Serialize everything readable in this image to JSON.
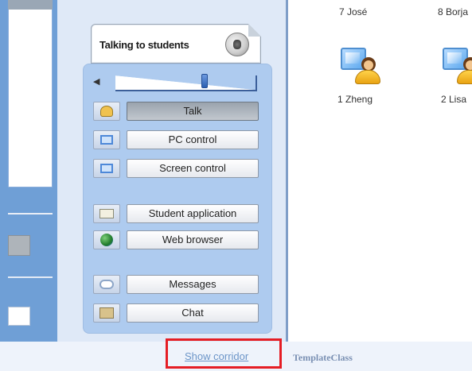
{
  "panel": {
    "tab_title": "Talking to students",
    "buttons": [
      {
        "label": "Talk",
        "icon": "talk-icon"
      },
      {
        "label": "PC control",
        "icon": "pc-control-icon"
      },
      {
        "label": "Screen control",
        "icon": "screen-control-icon"
      },
      {
        "label": "Student application",
        "icon": "student-application-icon"
      },
      {
        "label": "Web browser",
        "icon": "web-browser-icon"
      },
      {
        "label": "Messages",
        "icon": "messages-icon"
      },
      {
        "label": "Chat",
        "icon": "chat-icon"
      }
    ]
  },
  "students": {
    "top_row": [
      "7 José",
      "8 Borja"
    ],
    "icons_row": [
      "1 Zheng",
      "2 Lisa"
    ]
  },
  "bottom": {
    "show_corridor": "Show corridor",
    "template_class": "TemplateClass"
  },
  "colors": {
    "accent_red": "#e51d24",
    "panel_blue": "#aecbef",
    "link_blue": "#6c95c8"
  }
}
